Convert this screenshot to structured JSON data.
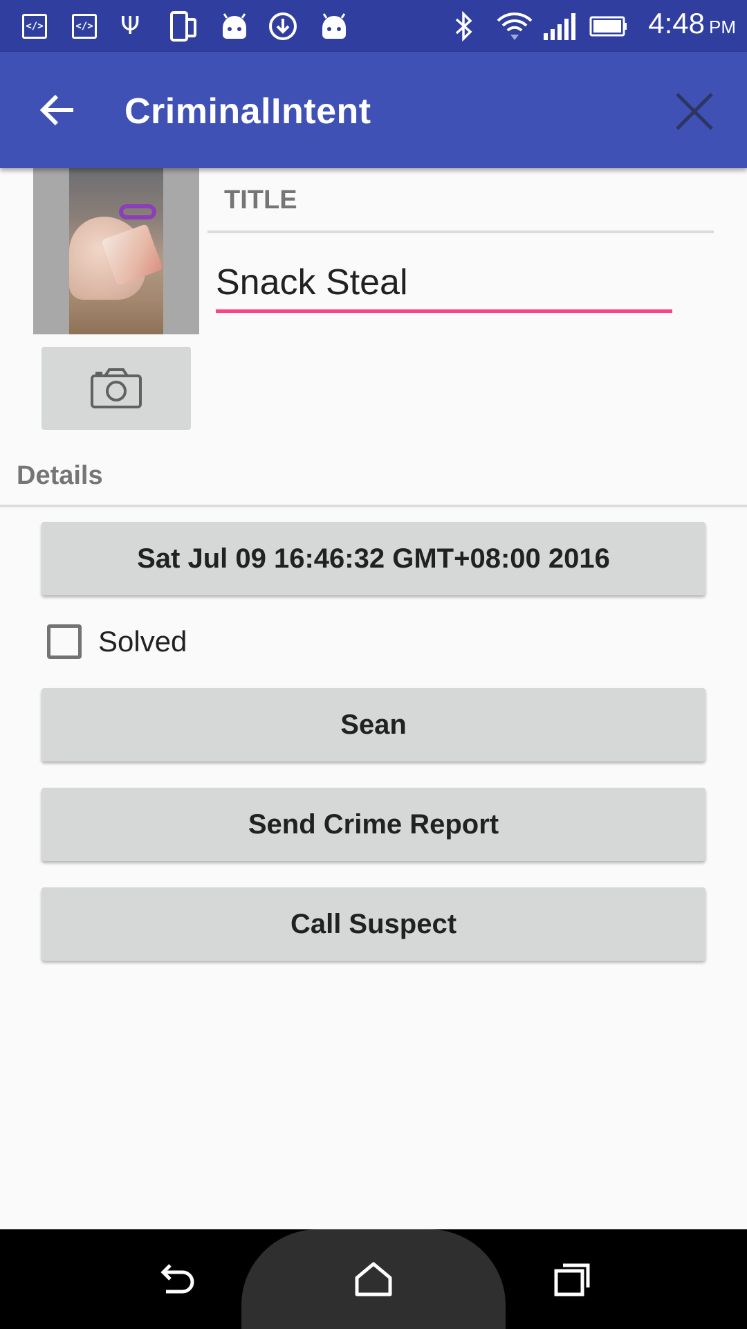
{
  "status_bar": {
    "time": "4:48",
    "ampm": "PM",
    "icons": [
      "code-icon",
      "code-icon",
      "usb-icon",
      "phone-sync-icon",
      "android-icon",
      "download-sync-icon",
      "android-icon",
      "bluetooth-icon",
      "wifi-icon",
      "signal-icon",
      "battery-icon"
    ],
    "code_glyph": "</>",
    "usb_glyph": "Ψ",
    "bluetooth_glyph": "✱"
  },
  "app_bar": {
    "title": "CriminalIntent",
    "back_icon": "arrow-left-icon",
    "close_icon": "close-icon",
    "color": "#3f51b5"
  },
  "crime": {
    "title_header": "TITLE",
    "title_value": "Snack Steal",
    "details_header": "Details",
    "date_button": "Sat Jul 09 16:46:32 GMT+08:00 2016",
    "solved_label": "Solved",
    "solved_checked": false,
    "suspect_button": "Sean",
    "report_button": "Send Crime Report",
    "call_button": "Call Suspect"
  },
  "colors": {
    "status_bar": "#303f9f",
    "accent": "#ff4081",
    "button_bg": "#d6d7d7",
    "background": "#fafafa"
  },
  "nav_bar": {
    "icons": [
      "back-icon",
      "home-icon",
      "recents-icon"
    ]
  }
}
